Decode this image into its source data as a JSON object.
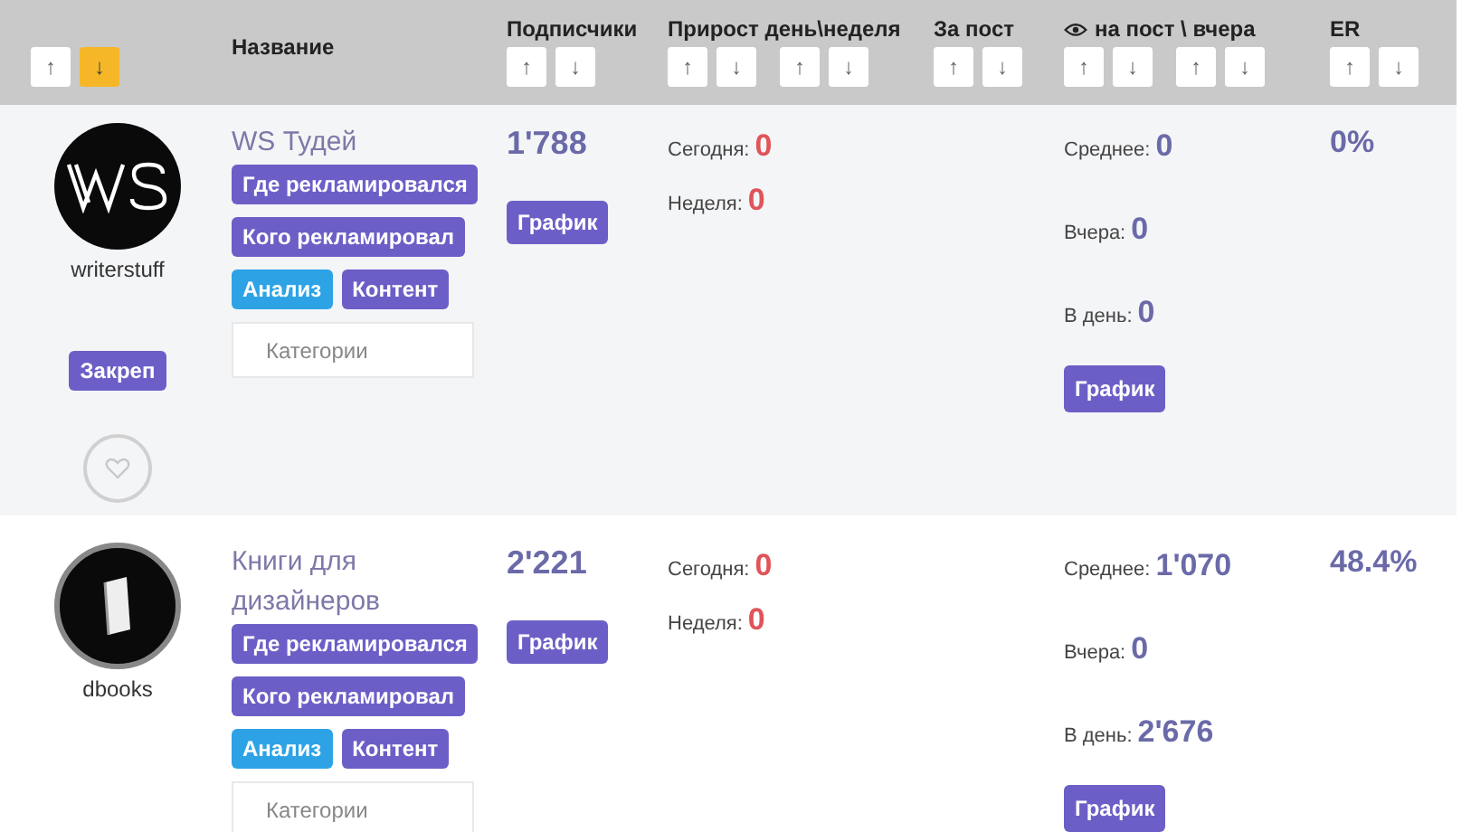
{
  "header": {
    "columns": [
      {
        "sort_groups": [
          [
            {
              "label": "↑",
              "selected": false
            },
            {
              "label": "↓",
              "selected": true
            }
          ]
        ]
      },
      {
        "title": "Название"
      },
      {
        "title": "Подписчики",
        "sort_groups": [
          [
            {
              "label": "↑",
              "selected": false
            },
            {
              "label": "↓",
              "selected": false
            }
          ]
        ]
      },
      {
        "title": "Прирост день\\неделя",
        "sort_groups": [
          [
            {
              "label": "↑",
              "selected": false
            },
            {
              "label": "↓",
              "selected": false
            }
          ],
          [
            {
              "label": "↑",
              "selected": false
            },
            {
              "label": "↓",
              "selected": false
            }
          ]
        ]
      },
      {
        "title": "За пост",
        "sort_groups": [
          [
            {
              "label": "↑",
              "selected": false
            },
            {
              "label": "↓",
              "selected": false
            }
          ]
        ]
      },
      {
        "title": "на пост \\ вчера",
        "eye": true,
        "sort_groups": [
          [
            {
              "label": "↑",
              "selected": false
            },
            {
              "label": "↓",
              "selected": false
            }
          ],
          [
            {
              "label": "↑",
              "selected": false
            },
            {
              "label": "↓",
              "selected": false
            }
          ]
        ]
      },
      {
        "title": "ER",
        "sort_groups": [
          [
            {
              "label": "↑",
              "selected": false
            },
            {
              "label": "↓",
              "selected": false
            }
          ]
        ]
      }
    ]
  },
  "rows": [
    {
      "avatar": {
        "kind": "ws"
      },
      "username": "writerstuff",
      "pin": "Закреп",
      "title": "WS Тудей",
      "actions": [
        {
          "label": "Где рекламировался",
          "kind": "primary"
        },
        {
          "label": "Кого рекламировал",
          "kind": "primary"
        },
        {
          "label": "Анализ",
          "kind": "info"
        },
        {
          "label": "Контент",
          "kind": "primary"
        }
      ],
      "categories_placeholder": "Категории",
      "subscribers": "1'788",
      "subscribers_chart": "График",
      "growth": [
        {
          "label": "Сегодня:",
          "value": "0"
        },
        {
          "label": "Неделя:",
          "value": "0"
        }
      ],
      "views": [
        {
          "label": "Среднее:",
          "value": "0"
        },
        {
          "label": "Вчера:",
          "value": "0"
        },
        {
          "label": "В день:",
          "value": "0"
        }
      ],
      "views_chart": "График",
      "er": "0%"
    },
    {
      "avatar": {
        "kind": "book"
      },
      "username": "dbooks",
      "title": "Книги для дизайнеров",
      "actions": [
        {
          "label": "Где рекламировался",
          "kind": "primary"
        },
        {
          "label": "Кого рекламировал",
          "kind": "primary"
        },
        {
          "label": "Анализ",
          "kind": "info"
        },
        {
          "label": "Контент",
          "kind": "primary"
        }
      ],
      "categories_placeholder": "Категории",
      "subscribers": "2'221",
      "subscribers_chart": "График",
      "growth": [
        {
          "label": "Сегодня:",
          "value": "0"
        },
        {
          "label": "Неделя:",
          "value": "0"
        }
      ],
      "views": [
        {
          "label": "Среднее:",
          "value": "1'070"
        },
        {
          "label": "Вчера:",
          "value": "0"
        },
        {
          "label": "В день:",
          "value": "2'676"
        }
      ],
      "views_chart": "График",
      "er": "48.4%"
    }
  ]
}
